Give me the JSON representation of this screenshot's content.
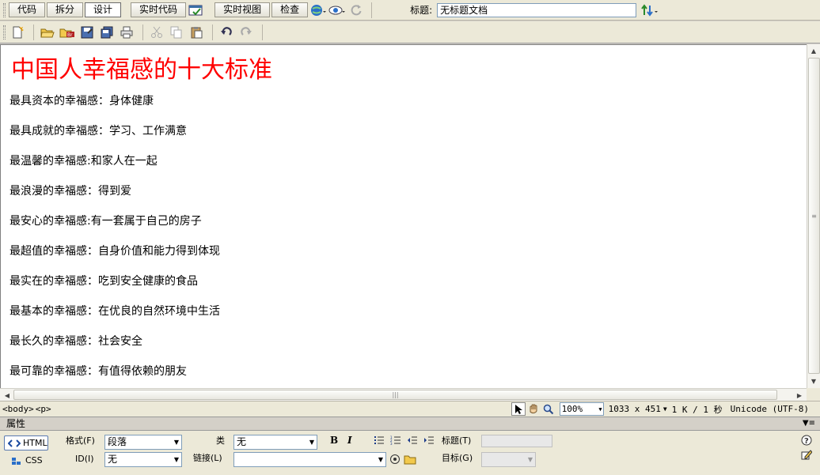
{
  "toolbar": {
    "view_buttons": [
      "代码",
      "拆分",
      "设计"
    ],
    "active_view": "设计",
    "live_code": "实时代码",
    "live_view": "实时视图",
    "inspect": "检查",
    "title_label": "标题:",
    "title_value": "无标题文档"
  },
  "document": {
    "heading": "中国人幸福感的十大标准",
    "lines": [
      "最具资本的幸福感：身体健康",
      "最具成就的幸福感：学习、工作满意",
      "最温馨的幸福感:和家人在一起",
      "最浪漫的幸福感：得到爱",
      "最安心的幸福感:有一套属于自己的房子",
      "最超值的幸福感：自身价值和能力得到体现",
      "最实在的幸福感：吃到安全健康的食品",
      "最基本的幸福感：在优良的自然环境中生活",
      "最长久的幸福感：社会安全",
      "最可靠的幸福感：有值得依赖的朋友"
    ]
  },
  "statusbar": {
    "tags": [
      "<body>",
      "<p>"
    ],
    "zoom": "100%",
    "size": "1033 x 451",
    "filesize": "1 K / 1 秒",
    "encoding": "Unicode (UTF-8)"
  },
  "properties": {
    "header": "属性",
    "html_label": "HTML",
    "css_label": "CSS",
    "format_label": "格式(F)",
    "format_value": "段落",
    "class_label": "类",
    "class_value": "无",
    "id_label": "ID(I)",
    "id_value": "无",
    "link_label": "链接(L)",
    "link_value": "",
    "title_label": "标题(T)",
    "target_label": "目标(G)",
    "bold": "B",
    "italic": "I"
  },
  "colors": {
    "heading": "#ff0000"
  }
}
